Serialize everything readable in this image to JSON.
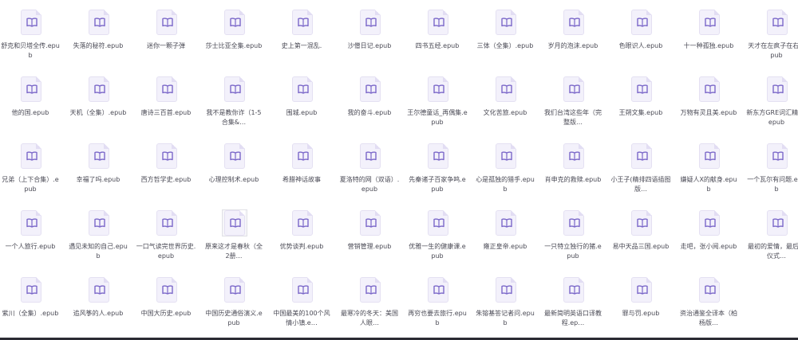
{
  "files": [
    "舒克和贝塔全传.epub",
    "失落的秘符.epub",
    "迷你一颗子弹",
    "莎士比亚全集.epub",
    "史上第一混乱.",
    "沙僧日记.epub",
    "四书五经.epub",
    "三体（全集）.epub",
    "岁月的泡沫.epub",
    "色眼识人.epub",
    "十一种孤独.epub",
    "天才在左疯子在右.epub",
    "他的国.epub",
    "天机（全集）.epub",
    "唐诗三百首.epub",
    "我不是教你诈（1-5合集&…",
    "围城.epub",
    "我的奋斗.epub",
    "王尔德童话_再偶集.epub",
    "文化苦旅.epub",
    "我们台湾这些年（完整版…",
    "王朔文集.epub",
    "万物有灵且美.epub",
    "新东方GRE词汇精选.epub",
    "兄弟（上下合集）.epub",
    "幸福了吗.epub",
    "西方哲学史.epub",
    "心理控制术.epub",
    "希腊神话故事",
    "夏洛特的网（双语）.epub",
    "先秦诸子百家争鸣.epub",
    "心是孤独的猎手.epub",
    "肖申克的救赎.epub",
    "小王子(精排四语插图版…",
    "嫌疑人X的献身.epub",
    "一个瓦尔有问题.epub",
    "一个人旅行.epub",
    "遇见未知的自己.epub",
    "一口气读完世界历史.epub",
    "原来这才是春秋（全2册…",
    "优势谈判.epub",
    "营销管理.epub",
    "优雅一生的健康课.epub",
    "雍正皇帝.epub",
    "一只特立独行的猪.epub",
    "易中天品三国.epub",
    "走吧，张小阅.epub",
    "最初的爱情，最后的仪式…",
    "紫川（全集）.epub",
    "追风筝的人.epub",
    "中国大历史.epub",
    "中国历史通俗演义.epub",
    "中国最美的100个风情小镇.e…",
    "最寒冷的冬天：美国人眼…",
    "再穷也要去旅行.epub",
    "朱镕基答记者问.epub",
    "最新简明英语口译教程.ep…",
    "罪与罚.epub",
    "资治通鉴全译本（柏杨版…"
  ],
  "selected_index": 39
}
